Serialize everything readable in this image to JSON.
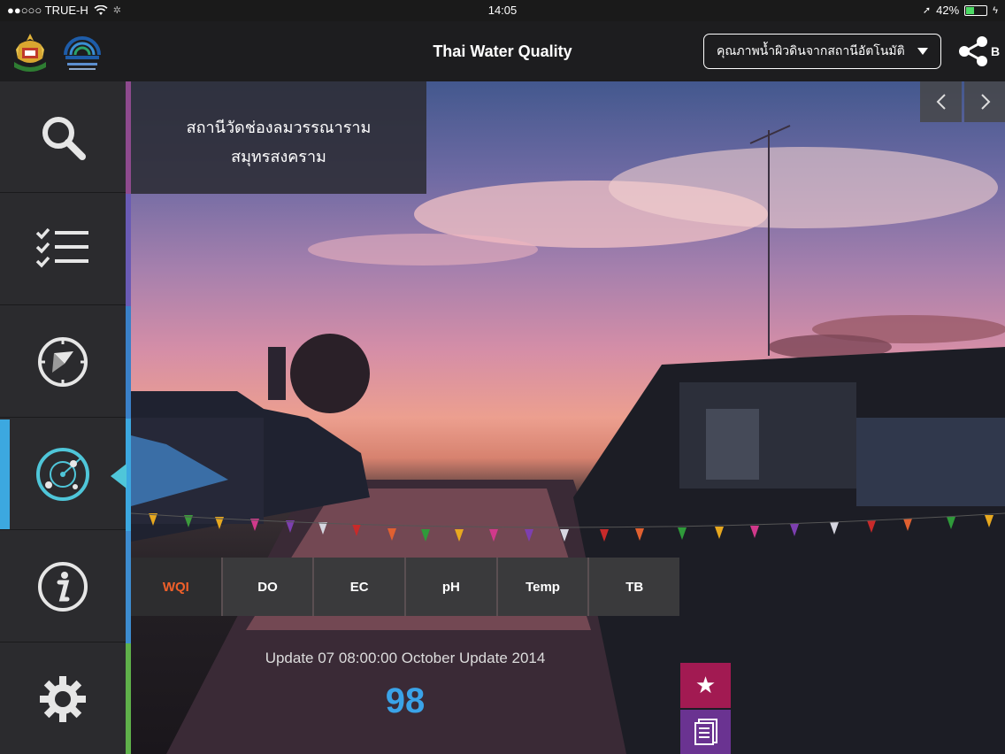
{
  "status_bar": {
    "carrier": "●●○○○ TRUE-H",
    "time": "14:05",
    "battery": "42%",
    "battery_level": 0.42
  },
  "header": {
    "title": "Thai Water Quality",
    "dropdown_value": "คุณภาพน้ำผิวดินจากสถานีอัตโนมัติ",
    "share_letter": "B"
  },
  "sidebar": {
    "items": [
      {
        "icon": "search-icon"
      },
      {
        "icon": "checklist-icon"
      },
      {
        "icon": "compass-icon"
      },
      {
        "icon": "radar-icon",
        "active": true
      },
      {
        "icon": "info-icon"
      },
      {
        "icon": "gear-icon"
      }
    ],
    "strip_colors": [
      "#8e4a8e",
      "#6a5bb5",
      "#3a80c8",
      "#3ca8e0",
      "#3d8ccf",
      "#5fb04a"
    ],
    "active_color": "#3ca8e0"
  },
  "station": {
    "name": "สถานีวัดช่องลมวรรณาราม",
    "province": "สมุทรสงคราม"
  },
  "tabs": [
    {
      "label": "WQI",
      "active": true
    },
    {
      "label": "DO"
    },
    {
      "label": "EC"
    },
    {
      "label": "pH"
    },
    {
      "label": "Temp"
    },
    {
      "label": "TB"
    }
  ],
  "reading": {
    "update_text": "Update  07 08:00:00 October Update 2014",
    "value": "98"
  },
  "colors": {
    "accent_orange": "#f0602a",
    "value_blue": "#3aa3e8",
    "favorite": "#a21a52",
    "document": "#6a3391"
  }
}
